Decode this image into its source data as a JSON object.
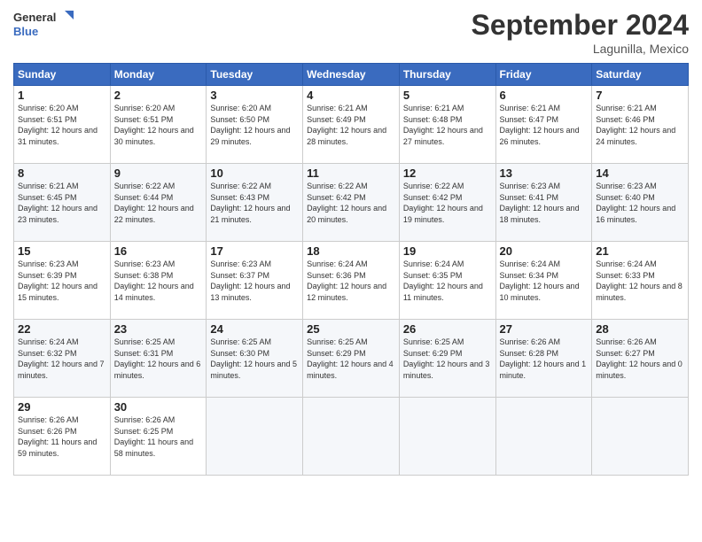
{
  "header": {
    "logo_line1": "General",
    "logo_line2": "Blue",
    "month_title": "September 2024",
    "location": "Lagunilla, Mexico"
  },
  "weekdays": [
    "Sunday",
    "Monday",
    "Tuesday",
    "Wednesday",
    "Thursday",
    "Friday",
    "Saturday"
  ],
  "weeks": [
    [
      {
        "day": "1",
        "sunrise": "Sunrise: 6:20 AM",
        "sunset": "Sunset: 6:51 PM",
        "daylight": "Daylight: 12 hours and 31 minutes."
      },
      {
        "day": "2",
        "sunrise": "Sunrise: 6:20 AM",
        "sunset": "Sunset: 6:51 PM",
        "daylight": "Daylight: 12 hours and 30 minutes."
      },
      {
        "day": "3",
        "sunrise": "Sunrise: 6:20 AM",
        "sunset": "Sunset: 6:50 PM",
        "daylight": "Daylight: 12 hours and 29 minutes."
      },
      {
        "day": "4",
        "sunrise": "Sunrise: 6:21 AM",
        "sunset": "Sunset: 6:49 PM",
        "daylight": "Daylight: 12 hours and 28 minutes."
      },
      {
        "day": "5",
        "sunrise": "Sunrise: 6:21 AM",
        "sunset": "Sunset: 6:48 PM",
        "daylight": "Daylight: 12 hours and 27 minutes."
      },
      {
        "day": "6",
        "sunrise": "Sunrise: 6:21 AM",
        "sunset": "Sunset: 6:47 PM",
        "daylight": "Daylight: 12 hours and 26 minutes."
      },
      {
        "day": "7",
        "sunrise": "Sunrise: 6:21 AM",
        "sunset": "Sunset: 6:46 PM",
        "daylight": "Daylight: 12 hours and 24 minutes."
      }
    ],
    [
      {
        "day": "8",
        "sunrise": "Sunrise: 6:21 AM",
        "sunset": "Sunset: 6:45 PM",
        "daylight": "Daylight: 12 hours and 23 minutes."
      },
      {
        "day": "9",
        "sunrise": "Sunrise: 6:22 AM",
        "sunset": "Sunset: 6:44 PM",
        "daylight": "Daylight: 12 hours and 22 minutes."
      },
      {
        "day": "10",
        "sunrise": "Sunrise: 6:22 AM",
        "sunset": "Sunset: 6:43 PM",
        "daylight": "Daylight: 12 hours and 21 minutes."
      },
      {
        "day": "11",
        "sunrise": "Sunrise: 6:22 AM",
        "sunset": "Sunset: 6:42 PM",
        "daylight": "Daylight: 12 hours and 20 minutes."
      },
      {
        "day": "12",
        "sunrise": "Sunrise: 6:22 AM",
        "sunset": "Sunset: 6:42 PM",
        "daylight": "Daylight: 12 hours and 19 minutes."
      },
      {
        "day": "13",
        "sunrise": "Sunrise: 6:23 AM",
        "sunset": "Sunset: 6:41 PM",
        "daylight": "Daylight: 12 hours and 18 minutes."
      },
      {
        "day": "14",
        "sunrise": "Sunrise: 6:23 AM",
        "sunset": "Sunset: 6:40 PM",
        "daylight": "Daylight: 12 hours and 16 minutes."
      }
    ],
    [
      {
        "day": "15",
        "sunrise": "Sunrise: 6:23 AM",
        "sunset": "Sunset: 6:39 PM",
        "daylight": "Daylight: 12 hours and 15 minutes."
      },
      {
        "day": "16",
        "sunrise": "Sunrise: 6:23 AM",
        "sunset": "Sunset: 6:38 PM",
        "daylight": "Daylight: 12 hours and 14 minutes."
      },
      {
        "day": "17",
        "sunrise": "Sunrise: 6:23 AM",
        "sunset": "Sunset: 6:37 PM",
        "daylight": "Daylight: 12 hours and 13 minutes."
      },
      {
        "day": "18",
        "sunrise": "Sunrise: 6:24 AM",
        "sunset": "Sunset: 6:36 PM",
        "daylight": "Daylight: 12 hours and 12 minutes."
      },
      {
        "day": "19",
        "sunrise": "Sunrise: 6:24 AM",
        "sunset": "Sunset: 6:35 PM",
        "daylight": "Daylight: 12 hours and 11 minutes."
      },
      {
        "day": "20",
        "sunrise": "Sunrise: 6:24 AM",
        "sunset": "Sunset: 6:34 PM",
        "daylight": "Daylight: 12 hours and 10 minutes."
      },
      {
        "day": "21",
        "sunrise": "Sunrise: 6:24 AM",
        "sunset": "Sunset: 6:33 PM",
        "daylight": "Daylight: 12 hours and 8 minutes."
      }
    ],
    [
      {
        "day": "22",
        "sunrise": "Sunrise: 6:24 AM",
        "sunset": "Sunset: 6:32 PM",
        "daylight": "Daylight: 12 hours and 7 minutes."
      },
      {
        "day": "23",
        "sunrise": "Sunrise: 6:25 AM",
        "sunset": "Sunset: 6:31 PM",
        "daylight": "Daylight: 12 hours and 6 minutes."
      },
      {
        "day": "24",
        "sunrise": "Sunrise: 6:25 AM",
        "sunset": "Sunset: 6:30 PM",
        "daylight": "Daylight: 12 hours and 5 minutes."
      },
      {
        "day": "25",
        "sunrise": "Sunrise: 6:25 AM",
        "sunset": "Sunset: 6:29 PM",
        "daylight": "Daylight: 12 hours and 4 minutes."
      },
      {
        "day": "26",
        "sunrise": "Sunrise: 6:25 AM",
        "sunset": "Sunset: 6:29 PM",
        "daylight": "Daylight: 12 hours and 3 minutes."
      },
      {
        "day": "27",
        "sunrise": "Sunrise: 6:26 AM",
        "sunset": "Sunset: 6:28 PM",
        "daylight": "Daylight: 12 hours and 1 minute."
      },
      {
        "day": "28",
        "sunrise": "Sunrise: 6:26 AM",
        "sunset": "Sunset: 6:27 PM",
        "daylight": "Daylight: 12 hours and 0 minutes."
      }
    ],
    [
      {
        "day": "29",
        "sunrise": "Sunrise: 6:26 AM",
        "sunset": "Sunset: 6:26 PM",
        "daylight": "Daylight: 11 hours and 59 minutes."
      },
      {
        "day": "30",
        "sunrise": "Sunrise: 6:26 AM",
        "sunset": "Sunset: 6:25 PM",
        "daylight": "Daylight: 11 hours and 58 minutes."
      },
      null,
      null,
      null,
      null,
      null
    ]
  ]
}
